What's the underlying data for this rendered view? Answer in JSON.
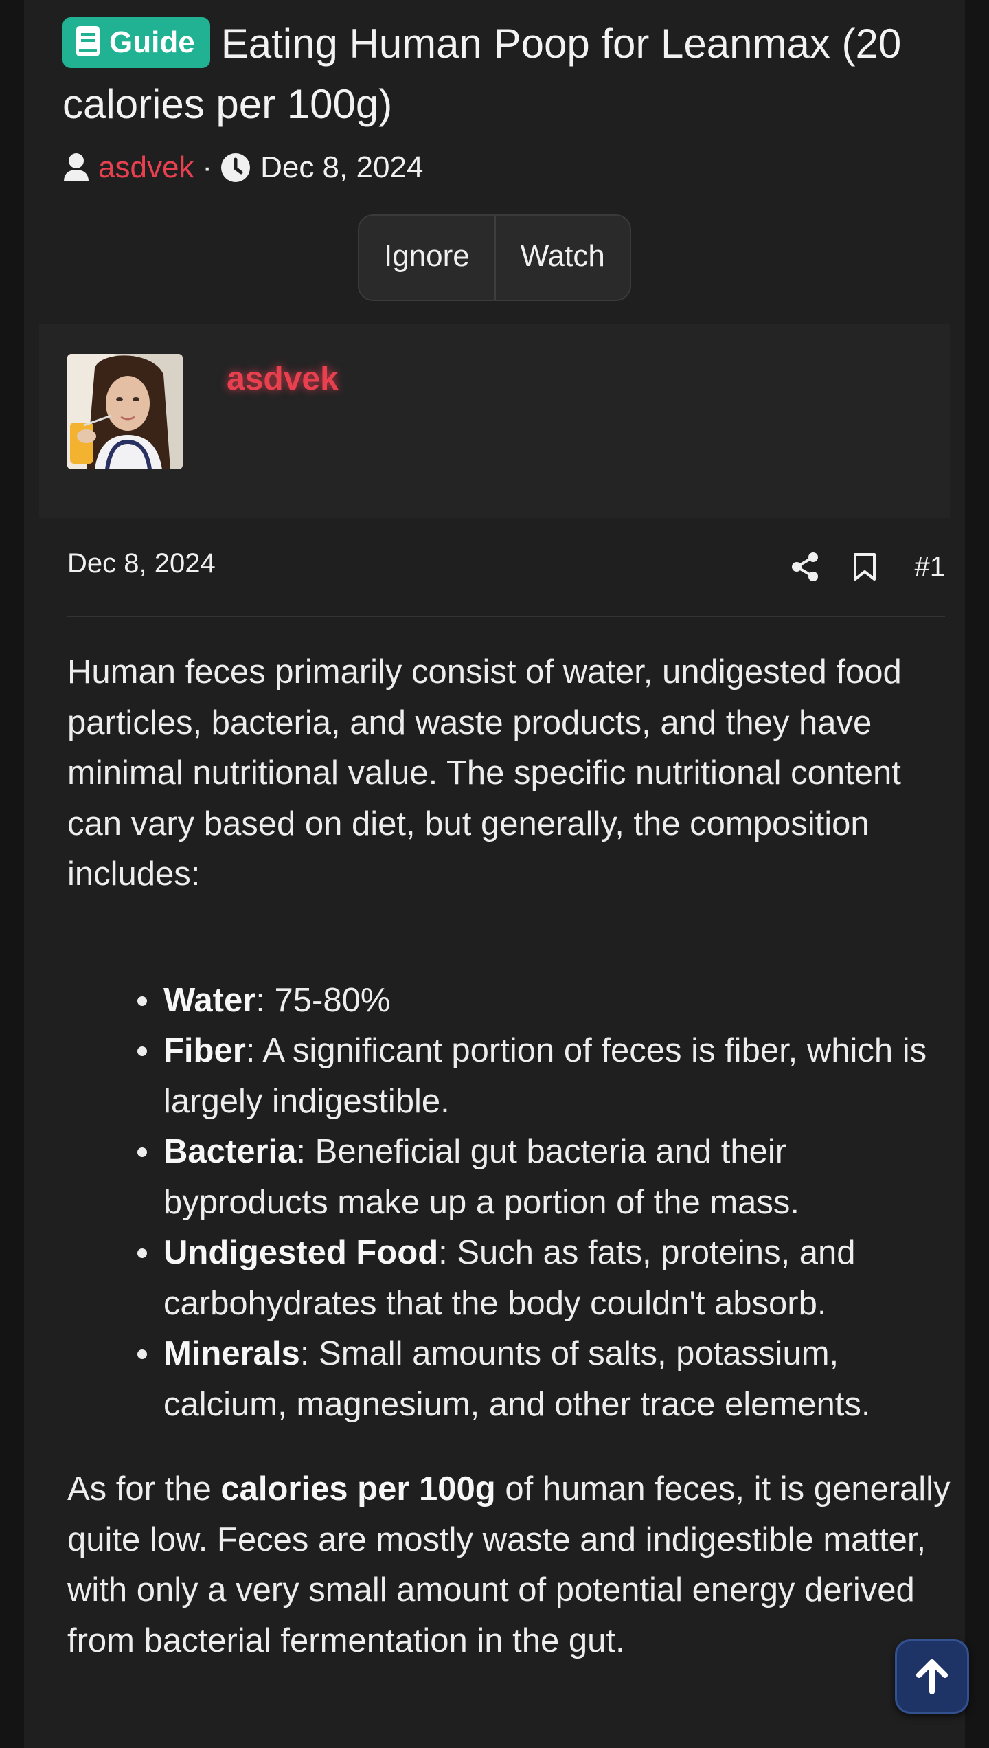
{
  "thread": {
    "prefix": "Guide",
    "prefix_color": "#20b293",
    "title": "Eating Human Poop for Leanmax (20 calories per 100g)",
    "author": "asdvek",
    "author_color": "#e8404f",
    "separator": "·",
    "date": "Dec 8, 2024"
  },
  "actions": {
    "ignore": "Ignore",
    "watch": "Watch"
  },
  "user": {
    "name": "asdvek",
    "avatar_icon": "avatar-photo"
  },
  "post": {
    "date": "Dec 8, 2024",
    "number": "#1",
    "icons": [
      "share-icon",
      "bookmark-icon"
    ],
    "intro": "Human feces primarily consist of water, undigested food particles, bacteria, and waste products, and they have minimal nutritional value. The specific nutritional content can vary based on diet, but generally, the composition includes:",
    "list": [
      {
        "term": "Water",
        "text": ": 75-80%"
      },
      {
        "term": "Fiber",
        "text": ": A significant portion of feces is fiber, which is largely indigestible."
      },
      {
        "term": "Bacteria",
        "text": ": Beneficial gut bacteria and their byproducts make up a portion of the mass."
      },
      {
        "term": "Undigested Food",
        "text": ": Such as fats, proteins, and carbohydrates that the body couldn't absorb."
      },
      {
        "term": "Minerals",
        "text": ": Small amounts of salts, potassium, calcium, magnesium, and other trace elements."
      }
    ],
    "outro_before": "As for the ",
    "outro_bold": "calories per 100g",
    "outro_after": " of human feces, it is generally quite low. Feces are mostly waste and indigestible matter, with only a very small amount of potential energy derived from bacterial fermentation in the gut."
  },
  "scroll_top_icon": "arrow-up-icon",
  "accent_blue": "#1f3466"
}
